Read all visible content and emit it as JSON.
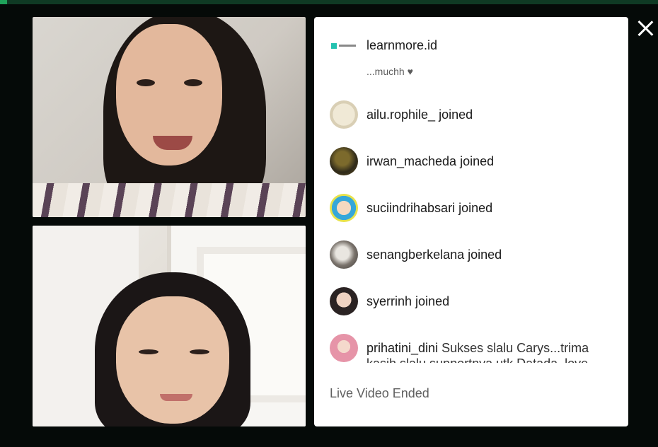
{
  "header": {
    "account_name": "learnmore.id"
  },
  "faded_comment": "...muchh ♥",
  "comments": [
    {
      "username": "ailu.rophile_",
      "action": "joined",
      "body": ""
    },
    {
      "username": "irwan_macheda",
      "action": "joined",
      "body": ""
    },
    {
      "username": "suciindrihabsari",
      "action": "joined",
      "body": ""
    },
    {
      "username": "senangberkelana",
      "action": "joined",
      "body": ""
    },
    {
      "username": "syerrinh",
      "action": "joined",
      "body": ""
    },
    {
      "username": "prihatini_dini",
      "action": "",
      "body": "Sukses slalu Carys...trima kasih slalu supportnya utk Datada, love"
    }
  ],
  "footer": {
    "status": "Live Video Ended"
  },
  "icons": {
    "close": "close-icon",
    "logo": "learnmore-logo-icon"
  },
  "colors": {
    "panel_bg": "#ffffff",
    "page_bg": "#050a08",
    "accent": "#1fa35a"
  }
}
